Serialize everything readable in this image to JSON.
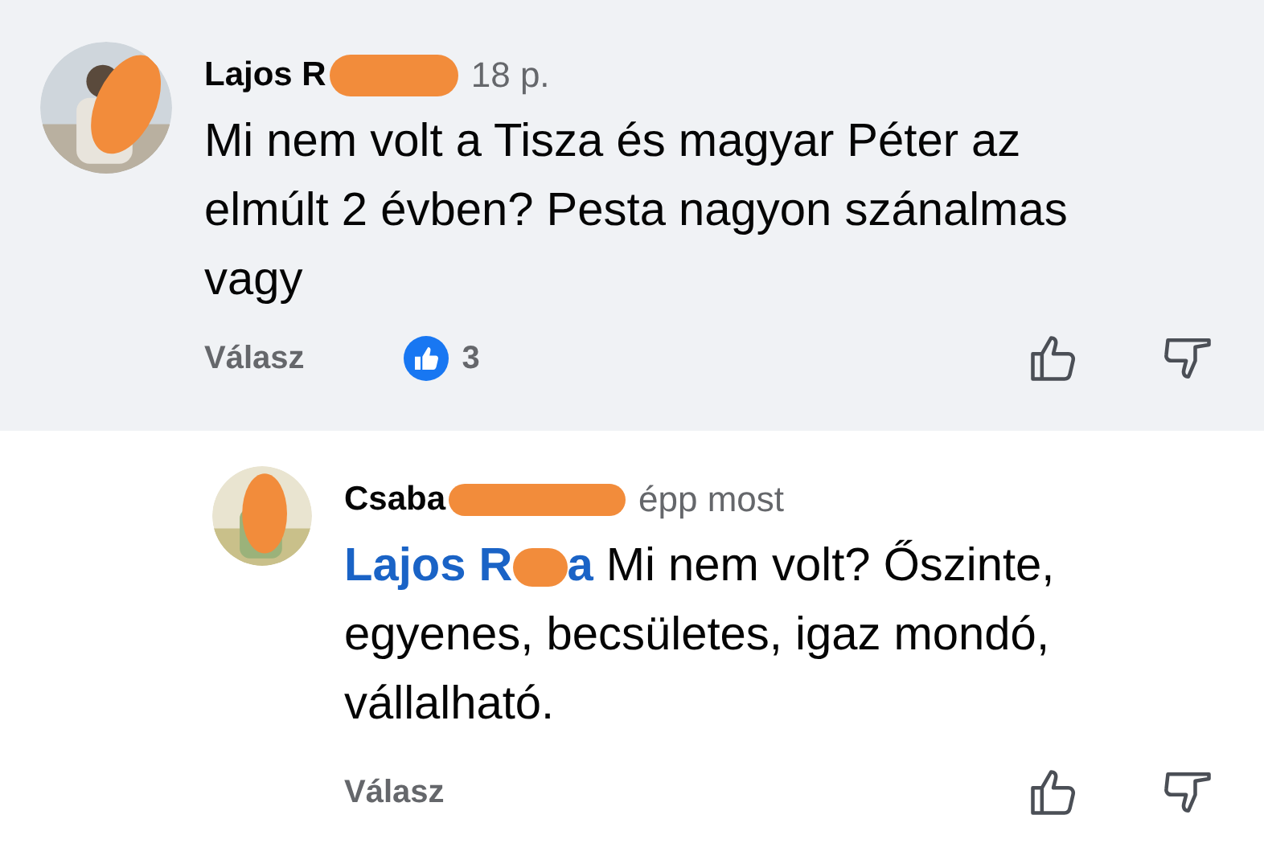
{
  "comments": [
    {
      "author": "Lajos R",
      "time": "18 p.",
      "text": "Mi nem volt a Tisza és magyar Péter az elmúlt 2 évben? Pesta nagyon szánalmas vagy",
      "reply_label": "Válasz",
      "reaction_count": "3",
      "highlighted": true,
      "reply": false
    },
    {
      "author": "Csaba",
      "time": "épp most",
      "mention_parts": [
        "Lajos R",
        "a"
      ],
      "text": "Mi nem volt? Őszinte, egyenes, becsületes, igaz mondó, vállalható.",
      "reply_label": "Válasz",
      "highlighted": false,
      "reply": true
    }
  ]
}
